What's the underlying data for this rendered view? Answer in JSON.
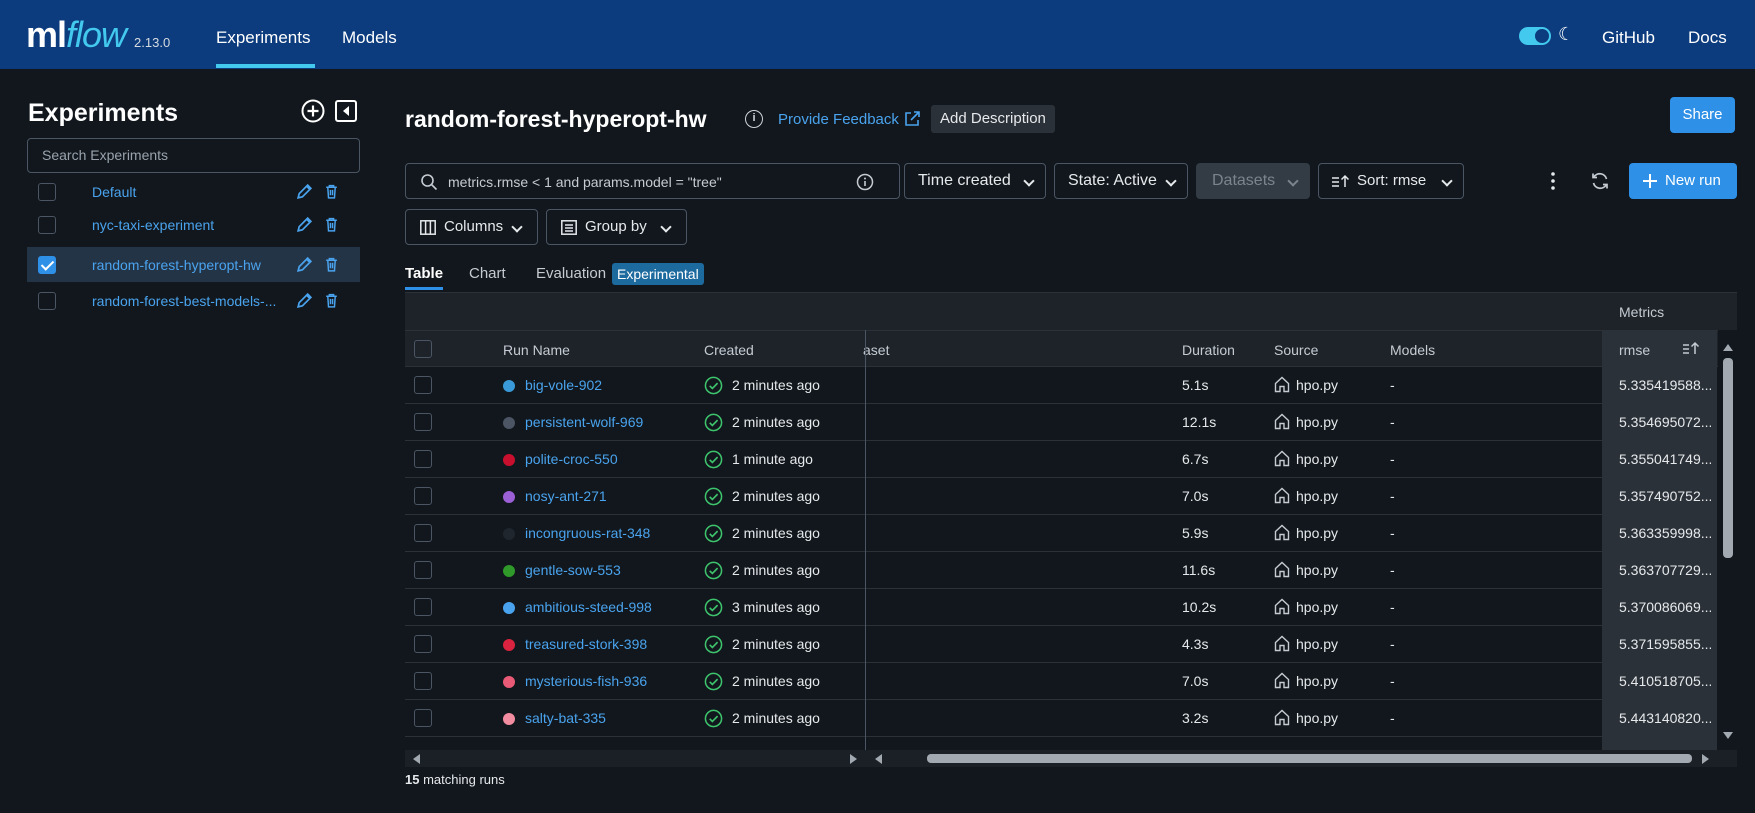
{
  "app": {
    "logo_ml": "ml",
    "logo_flow": "flow",
    "version": "2.13.0",
    "nav": [
      "Experiments",
      "Models"
    ],
    "links": [
      "GitHub",
      "Docs"
    ]
  },
  "sidebar": {
    "title": "Experiments",
    "search_placeholder": "Search Experiments",
    "experiments": [
      {
        "name": "Default",
        "checked": false
      },
      {
        "name": "nyc-taxi-experiment",
        "checked": false
      },
      {
        "name": "random-forest-hyperopt-hw",
        "checked": true
      },
      {
        "name": "random-forest-best-models-...",
        "checked": false
      }
    ]
  },
  "header": {
    "title": "random-forest-hyperopt-hw",
    "feedback": "Provide Feedback",
    "add_description": "Add Description",
    "share": "Share"
  },
  "toolbar": {
    "filter": "metrics.rmse < 1 and params.model = \"tree\"",
    "time_created": "Time created",
    "state": "State: Active",
    "datasets": "Datasets",
    "sort": "Sort: rmse",
    "new_run": "New run",
    "columns": "Columns",
    "group_by": "Group by"
  },
  "tabs": [
    "Table",
    "Chart",
    "Evaluation"
  ],
  "experimental_badge": "Experimental",
  "table": {
    "group_header": "Metrics",
    "headers": {
      "run_name": "Run Name",
      "created": "Created",
      "dataset": "aset",
      "duration": "Duration",
      "source": "Source",
      "models": "Models",
      "rmse": "rmse"
    },
    "rows": [
      {
        "name": "big-vole-902",
        "color": "#3a9ad9",
        "created": "2 minutes ago",
        "duration": "5.1s",
        "source": "hpo.py",
        "models": "-",
        "rmse": "5.335419588..."
      },
      {
        "name": "persistent-wolf-969",
        "color": "#4b5563",
        "created": "2 minutes ago",
        "duration": "12.1s",
        "source": "hpo.py",
        "models": "-",
        "rmse": "5.354695072..."
      },
      {
        "name": "polite-croc-550",
        "color": "#c8102e",
        "created": "1 minute ago",
        "duration": "6.7s",
        "source": "hpo.py",
        "models": "-",
        "rmse": "5.355041749..."
      },
      {
        "name": "nosy-ant-271",
        "color": "#9b5fd6",
        "created": "2 minutes ago",
        "duration": "7.0s",
        "source": "hpo.py",
        "models": "-",
        "rmse": "5.357490752..."
      },
      {
        "name": "incongruous-rat-348",
        "color": "#1f262d",
        "created": "2 minutes ago",
        "duration": "5.9s",
        "source": "hpo.py",
        "models": "-",
        "rmse": "5.363359998..."
      },
      {
        "name": "gentle-sow-553",
        "color": "#2f9a2a",
        "created": "2 minutes ago",
        "duration": "11.6s",
        "source": "hpo.py",
        "models": "-",
        "rmse": "5.363707729..."
      },
      {
        "name": "ambitious-steed-998",
        "color": "#4aa3ee",
        "created": "3 minutes ago",
        "duration": "10.2s",
        "source": "hpo.py",
        "models": "-",
        "rmse": "5.370086069..."
      },
      {
        "name": "treasured-stork-398",
        "color": "#d9233f",
        "created": "2 minutes ago",
        "duration": "4.3s",
        "source": "hpo.py",
        "models": "-",
        "rmse": "5.371595855..."
      },
      {
        "name": "mysterious-fish-936",
        "color": "#e85a76",
        "created": "2 minutes ago",
        "duration": "7.0s",
        "source": "hpo.py",
        "models": "-",
        "rmse": "5.410518705..."
      },
      {
        "name": "salty-bat-335",
        "color": "#f28ca0",
        "created": "2 minutes ago",
        "duration": "3.2s",
        "source": "hpo.py",
        "models": "-",
        "rmse": "5.443140820..."
      }
    ]
  },
  "footer": {
    "count": "15",
    "suffix": " matching runs"
  },
  "colors": {
    "topbar": "#0c3c7d",
    "accent": "#2e90e6",
    "link": "#4aa3ee",
    "status_success": "#3ec46d"
  }
}
